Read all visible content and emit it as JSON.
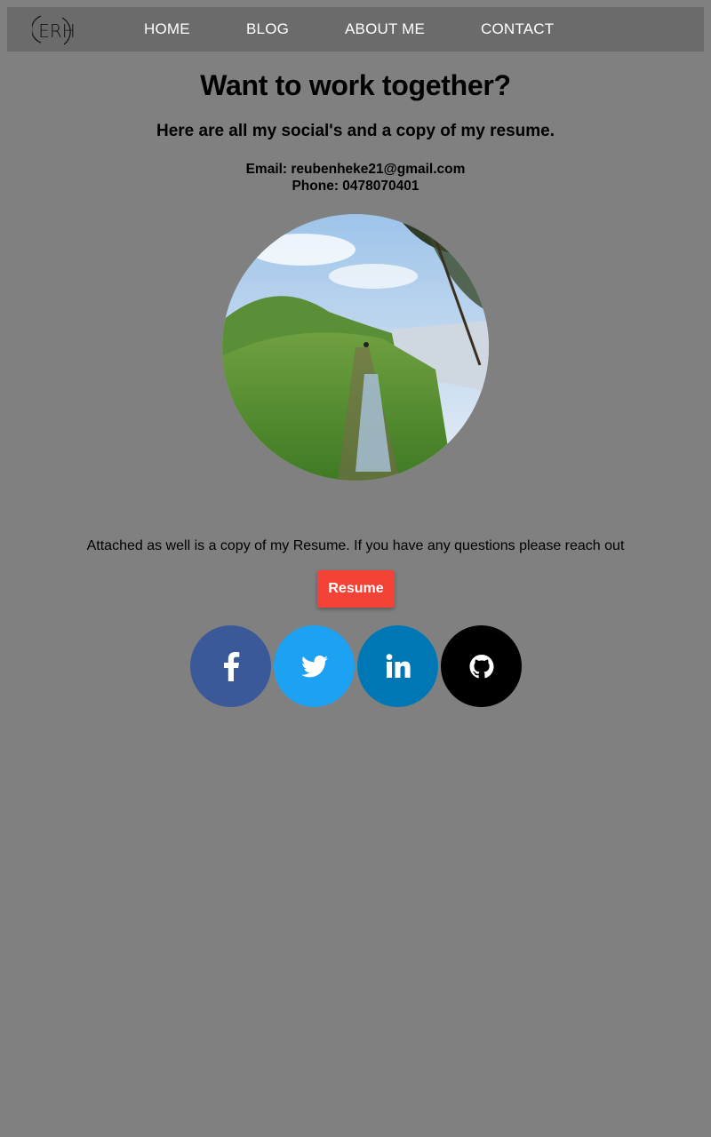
{
  "nav": {
    "logo_text": "ERH",
    "links": [
      "HOME",
      "BLOG",
      "ABOUT ME",
      "CONTACT"
    ]
  },
  "main": {
    "headline": "Want to work together?",
    "subhead": "Here are all my social's and a copy of my resume.",
    "email_line": "Email: reubenheke21@gmail.com",
    "phone_line": "Phone: 0478070401",
    "photo_alt": "Coastal walking track",
    "attached_text": "Attached as well is a copy of my Resume. If you have any questions please reach out",
    "resume_label": "Resume"
  },
  "social": [
    {
      "name": "facebook",
      "icon": "facebook-icon",
      "color": "#3b5998"
    },
    {
      "name": "twitter",
      "icon": "twitter-icon",
      "color": "#1da1f2"
    },
    {
      "name": "linkedin",
      "icon": "linkedin-icon",
      "color": "#0077b5"
    },
    {
      "name": "github",
      "icon": "github-icon",
      "color": "#000000"
    }
  ],
  "colors": {
    "page_bg": "#808080",
    "nav_bg": "#6a6b6a",
    "resume_button": "#f44336"
  }
}
